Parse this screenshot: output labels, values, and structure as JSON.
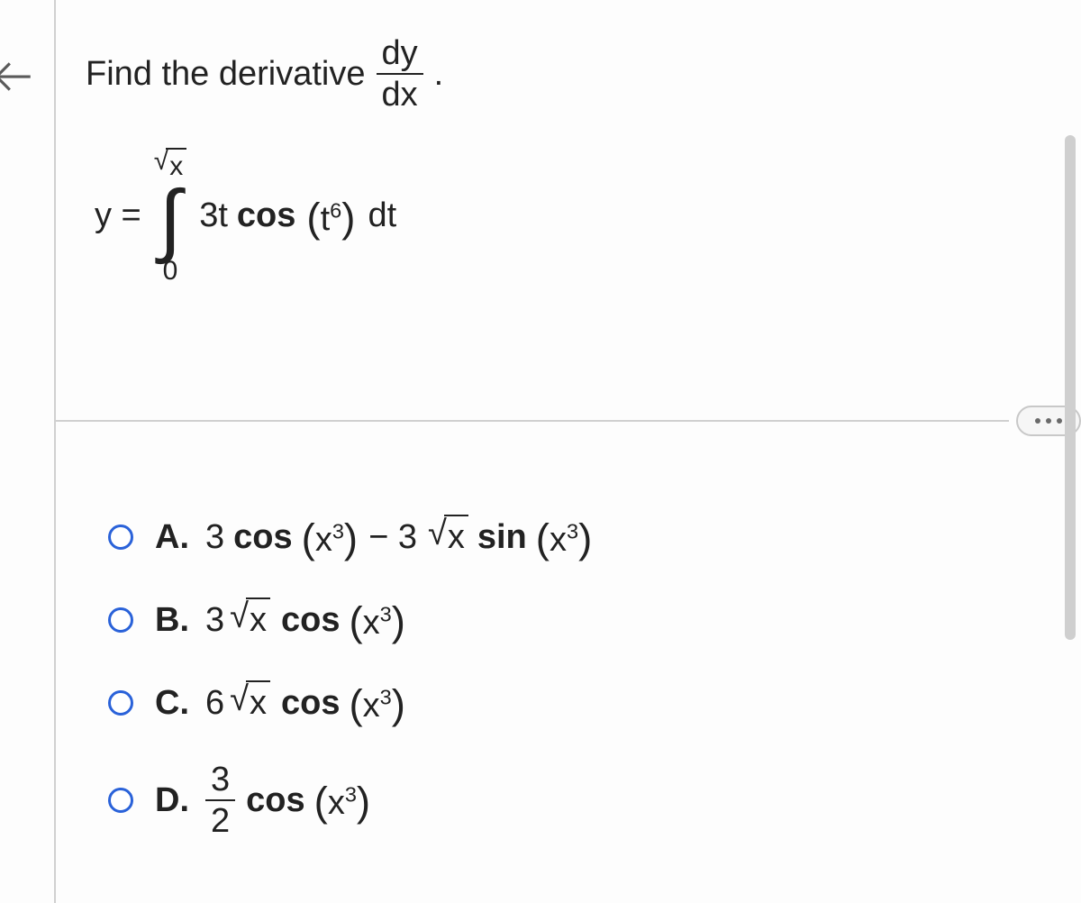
{
  "prompt": {
    "lead": "Find the derivative",
    "frac_num": "dy",
    "frac_den": "dx",
    "tail": "."
  },
  "equation": {
    "lhs": "y =",
    "upper_root_body": "x",
    "lower": "0",
    "coef": "3t",
    "fn": "cos",
    "arg_base": "t",
    "arg_exp": "6",
    "dt": "dt"
  },
  "options": {
    "a": {
      "letter": "A.",
      "t1_coef": "3",
      "t1_fn": "cos",
      "t1_base": "x",
      "t1_exp": "3",
      "minus": "− 3",
      "sq_body": "x",
      "t2_fn": "sin",
      "t2_base": "x",
      "t2_exp": "3"
    },
    "b": {
      "letter": "B.",
      "coef": "3",
      "sq_body": "x",
      "fn": "cos",
      "base": "x",
      "exp": "3"
    },
    "c": {
      "letter": "C.",
      "coef": "6",
      "sq_body": "x",
      "fn": "cos",
      "base": "x",
      "exp": "3"
    },
    "d": {
      "letter": "D.",
      "frac_num": "3",
      "frac_den": "2",
      "fn": "cos",
      "base": "x",
      "exp": "3"
    }
  }
}
